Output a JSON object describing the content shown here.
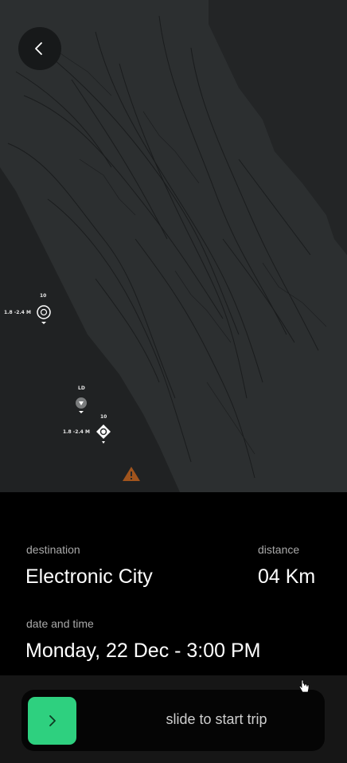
{
  "map": {
    "markers": [
      {
        "count": "10",
        "range": "1.8 -2.4",
        "unit": "M",
        "type": "pin-icon"
      },
      {
        "count": "LD",
        "range": "",
        "unit": "",
        "type": "anchor-icon"
      },
      {
        "count": "10",
        "range": "1.8 -2.4",
        "unit": "M",
        "type": "diamond-icon"
      }
    ],
    "warning": "warning-icon"
  },
  "back_button": {
    "icon": "chevron-left-icon"
  },
  "trip": {
    "destination_label": "destination",
    "destination_value": "Electronic City",
    "distance_label": "distance",
    "distance_value": "04 Km",
    "datetime_label": "date and time",
    "datetime_value": "Monday, 22 Dec - 3:00 PM"
  },
  "slider": {
    "label": "slide to start trip",
    "handle_icon": "chevron-right-icon",
    "accent": "#2ed07f"
  }
}
